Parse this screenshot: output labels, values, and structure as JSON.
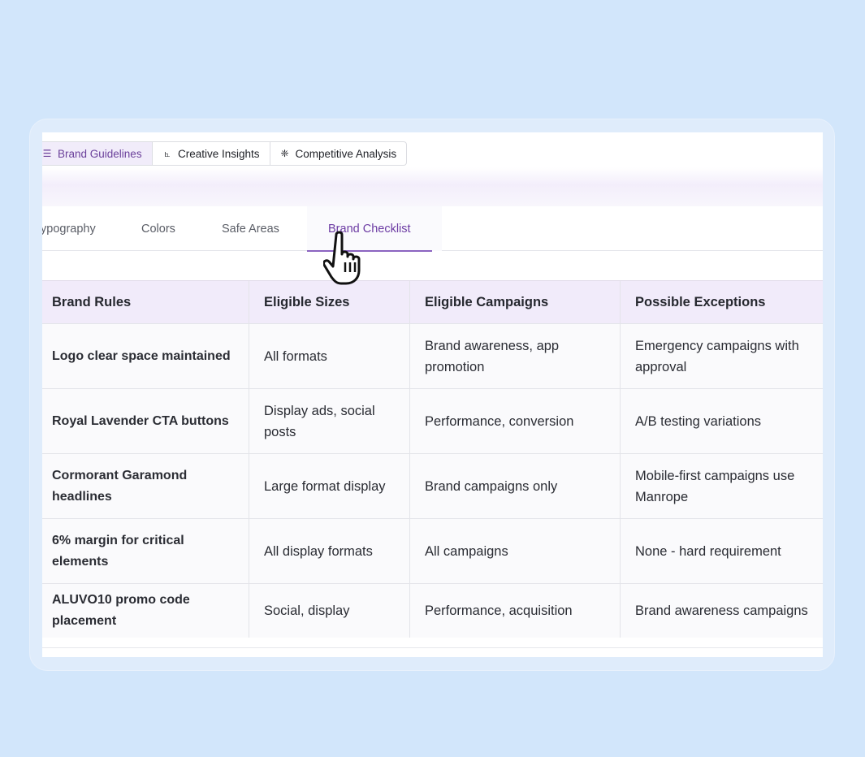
{
  "top_tabs": [
    {
      "label": "Brand Guidelines",
      "icon": "list-icon",
      "glyph": "☰",
      "active": true
    },
    {
      "label": "Creative Insights",
      "icon": "chart-icon",
      "glyph": "⦜",
      "active": false
    },
    {
      "label": "Competitive Analysis",
      "icon": "target-icon",
      "glyph": "❈",
      "active": false
    }
  ],
  "sub_tabs": [
    {
      "label": "ypography",
      "active": false
    },
    {
      "label": "Colors",
      "active": false
    },
    {
      "label": "Safe Areas",
      "active": false
    },
    {
      "label": "Brand Checklist",
      "active": true
    }
  ],
  "table": {
    "headers": [
      "Brand Rules",
      "Eligible Sizes",
      "Eligible Campaigns",
      "Possible Exceptions"
    ],
    "rows": [
      [
        "Logo clear space maintained",
        "All formats",
        "Brand awareness, app promotion",
        "Emergency campaigns with approval"
      ],
      [
        "Royal Lavender CTA buttons",
        "Display ads, social posts",
        "Performance, conversion",
        "A/B testing variations"
      ],
      [
        "Cormorant Garamond headlines",
        "Large format display",
        "Brand campaigns only",
        "Mobile-first campaigns use Manrope"
      ],
      [
        "6% margin for critical elements",
        "All display formats",
        "All campaigns",
        "None - hard requirement"
      ],
      [
        "ALUVO10 promo code placement",
        "Social, display",
        "Performance, acquisition",
        "Brand awareness campaigns"
      ]
    ]
  },
  "colors": {
    "accent": "#6c3ba3",
    "background": "#d2e6fb",
    "header_row": "#f1ebfa"
  }
}
